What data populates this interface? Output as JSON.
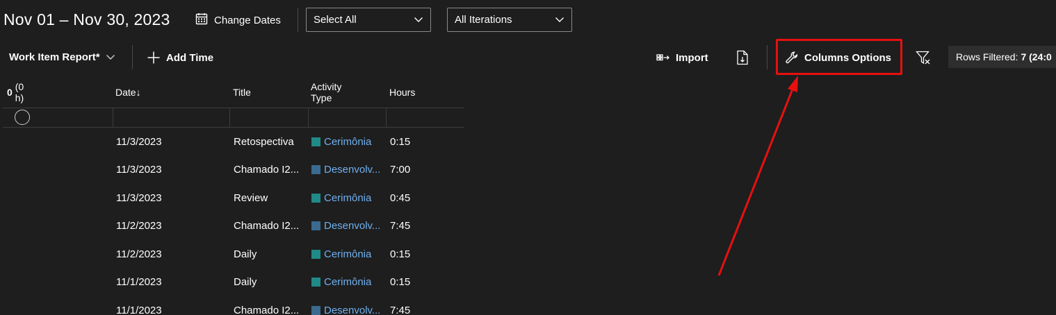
{
  "header": {
    "date_range": "Nov 01 – Nov 30, 2023",
    "change_dates_label": "Change Dates",
    "select_all_value": "Select All",
    "iterations_value": "All Iterations"
  },
  "toolbar": {
    "report_label": "Work Item Report*",
    "add_time_label": "Add Time",
    "import_label": "Import",
    "columns_options_label": "Columns Options",
    "rows_filtered_label": "Rows Filtered:",
    "rows_filtered_value": "7 (24:0"
  },
  "grid": {
    "summary_count": "0",
    "summary_hours": "(0 h)",
    "columns": [
      "Date↓",
      "Title",
      "Activity Type",
      "Hours"
    ],
    "rows": [
      {
        "date": "11/3/2023",
        "title": "Retospectiva",
        "activity": "Cerimônia",
        "activity_color": "#1f8a87",
        "hours": "0:15"
      },
      {
        "date": "11/3/2023",
        "title": "Chamado I2...",
        "activity": "Desenvolv...",
        "activity_color": "#3a6a8f",
        "hours": "7:00"
      },
      {
        "date": "11/3/2023",
        "title": "Review",
        "activity": "Cerimônia",
        "activity_color": "#1f8a87",
        "hours": "0:45"
      },
      {
        "date": "11/2/2023",
        "title": "Chamado I2...",
        "activity": "Desenvolv...",
        "activity_color": "#3a6a8f",
        "hours": "7:45"
      },
      {
        "date": "11/2/2023",
        "title": "Daily",
        "activity": "Cerimônia",
        "activity_color": "#1f8a87",
        "hours": "0:15"
      },
      {
        "date": "11/1/2023",
        "title": "Daily",
        "activity": "Cerimônia",
        "activity_color": "#1f8a87",
        "hours": "0:15"
      },
      {
        "date": "11/1/2023",
        "title": "Chamado I2...",
        "activity": "Desenvolv...",
        "activity_color": "#3a6a8f",
        "hours": "7:45"
      }
    ]
  },
  "annotation": {
    "color": "#e8100f"
  }
}
